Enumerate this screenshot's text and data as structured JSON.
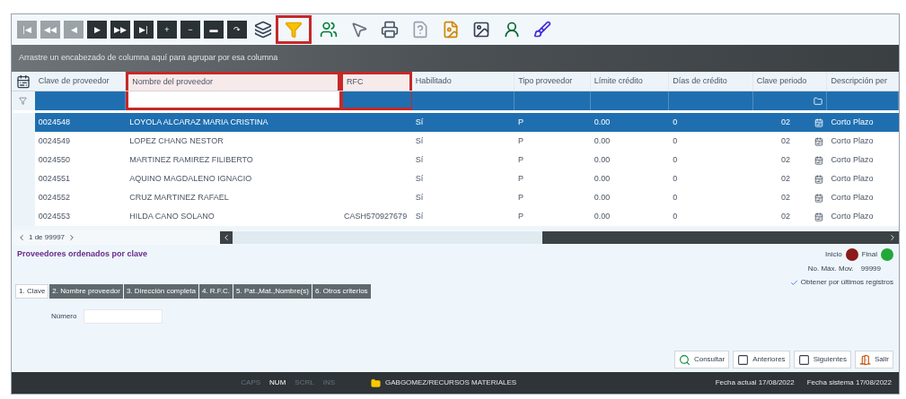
{
  "nav_buttons": [
    {
      "label": "|◀",
      "disabled": true
    },
    {
      "label": "◀◀",
      "disabled": true
    },
    {
      "label": "◀",
      "disabled": true
    },
    {
      "label": "▶",
      "disabled": false
    },
    {
      "label": "▶▶",
      "disabled": false
    },
    {
      "label": "▶|",
      "disabled": false
    },
    {
      "label": "+",
      "disabled": false
    },
    {
      "label": "−",
      "disabled": false
    },
    {
      "label": "▬",
      "disabled": false
    },
    {
      "label": "↷",
      "disabled": false
    }
  ],
  "filter_button": {
    "highlighted": true
  },
  "group_hint": "Arrastre un encabezado de columna aquí para agrupar por esa columna",
  "columns": [
    {
      "label": "Clave de proveedor",
      "highlighted": false
    },
    {
      "label": "Nombre del proveedor",
      "highlighted": true
    },
    {
      "label": "RFC",
      "highlighted": true
    },
    {
      "label": "Habilitado",
      "highlighted": false
    },
    {
      "label": "Tipo proveedor",
      "highlighted": false
    },
    {
      "label": "Límite crédito",
      "highlighted": false
    },
    {
      "label": "Días de crédito",
      "highlighted": false
    },
    {
      "label": "Clave periodo",
      "highlighted": false
    },
    {
      "label": "Descripción per",
      "highlighted": false
    }
  ],
  "rows": [
    {
      "selected": true,
      "cells": [
        "0024548",
        "LOYOLA ALCARAZ MARIA CRISTINA",
        "",
        "Sí",
        "P",
        "0.00",
        "0",
        "02",
        "Corto Plazo"
      ]
    },
    {
      "selected": false,
      "cells": [
        "0024549",
        "LOPEZ CHANG NESTOR",
        "",
        "Sí",
        "P",
        "0.00",
        "0",
        "02",
        "Corto Plazo"
      ]
    },
    {
      "selected": false,
      "cells": [
        "0024550",
        "MARTINEZ RAMIREZ FILIBERTO",
        "",
        "Sí",
        "P",
        "0.00",
        "0",
        "02",
        "Corto Plazo"
      ]
    },
    {
      "selected": false,
      "cells": [
        "0024551",
        "AQUINO MAGDALENO IGNACIO",
        "",
        "Sí",
        "P",
        "0.00",
        "0",
        "02",
        "Corto Plazo"
      ]
    },
    {
      "selected": false,
      "cells": [
        "0024552",
        "CRUZ MARTINEZ RAFAEL",
        "",
        "Sí",
        "P",
        "0.00",
        "0",
        "02",
        "Corto Plazo"
      ]
    },
    {
      "selected": false,
      "cells": [
        "0024553",
        "HILDA CANO SOLANO",
        "CASH570927679",
        "Sí",
        "P",
        "0.00",
        "0",
        "02",
        "Corto Plazo"
      ]
    }
  ],
  "pager": "1 de 99997",
  "order_note": "Proveedores ordenados por clave",
  "markers": [
    {
      "label": "Inicio",
      "color": "#8b1a1a"
    },
    {
      "label": "Final",
      "color": "#22a83a"
    }
  ],
  "max_mov": {
    "label": "No. Máx. Mov.",
    "value": "99999"
  },
  "last_records": {
    "label": "Obtener por últimos registros",
    "checked": true
  },
  "tabs": [
    {
      "label": "1. Clave",
      "selected": true
    },
    {
      "label": "2. Nombre proveedor",
      "selected": false
    },
    {
      "label": "3. Dirección completa",
      "selected": false
    },
    {
      "label": "4. R.F.C.",
      "selected": false
    },
    {
      "label": "5. Pat.,Mat.,Nombre(s)",
      "selected": false
    },
    {
      "label": "6. Otros criterios",
      "selected": false
    }
  ],
  "number_field": {
    "label": "Número"
  },
  "actions": [
    {
      "label": "Consultar",
      "kind": "search"
    },
    {
      "label": "Anteriores",
      "kind": "prev"
    },
    {
      "label": "Siguientes",
      "kind": "next"
    },
    {
      "label": "Salir",
      "kind": "exit"
    }
  ],
  "status": {
    "keys": [
      {
        "label": "CAPS",
        "on": false
      },
      {
        "label": "NUM",
        "on": true
      },
      {
        "label": "SCRL",
        "on": false
      },
      {
        "label": "INS",
        "on": false
      }
    ],
    "user": "GABGOMEZ/RECURSOS MATERIALES",
    "current_date": "Fecha actual 17/08/2022",
    "system_date": "Fecha sistema 17/08/2022"
  }
}
